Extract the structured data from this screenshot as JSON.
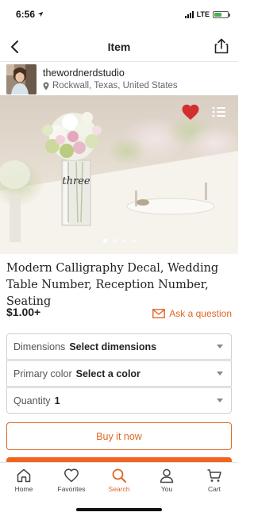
{
  "status_bar": {
    "time": "6:56",
    "network": "LTE"
  },
  "nav": {
    "title": "Item"
  },
  "shop": {
    "name": "thewordnerdstudio",
    "location": "Rockwall, Texas, United States"
  },
  "hero": {
    "image_description": "wedding table with floral centerpiece and vase labeled Three",
    "vase_text": "three",
    "slide_count": 4,
    "active_slide": 1,
    "favorited": true
  },
  "listing": {
    "title": "Modern Calligraphy Decal, Wedding Table Number, Reception Number, Seating",
    "price": "$1.00+",
    "ask_label": "Ask a question"
  },
  "options": {
    "dimensions": {
      "label": "Dimensions",
      "value": "Select dimensions"
    },
    "color": {
      "label": "Primary color",
      "value": "Select a color"
    },
    "quantity": {
      "label": "Quantity",
      "value": "1"
    }
  },
  "actions": {
    "buy_now": "Buy it now"
  },
  "tabs": [
    {
      "label": "Home",
      "icon": "home-icon"
    },
    {
      "label": "Favorites",
      "icon": "heart-icon"
    },
    {
      "label": "Search",
      "icon": "search-icon",
      "active": true
    },
    {
      "label": "You",
      "icon": "user-icon"
    },
    {
      "label": "Cart",
      "icon": "cart-icon"
    }
  ],
  "colors": {
    "accent": "#f1641e",
    "favorite": "#d32f2f",
    "battery": "#4caf50"
  }
}
